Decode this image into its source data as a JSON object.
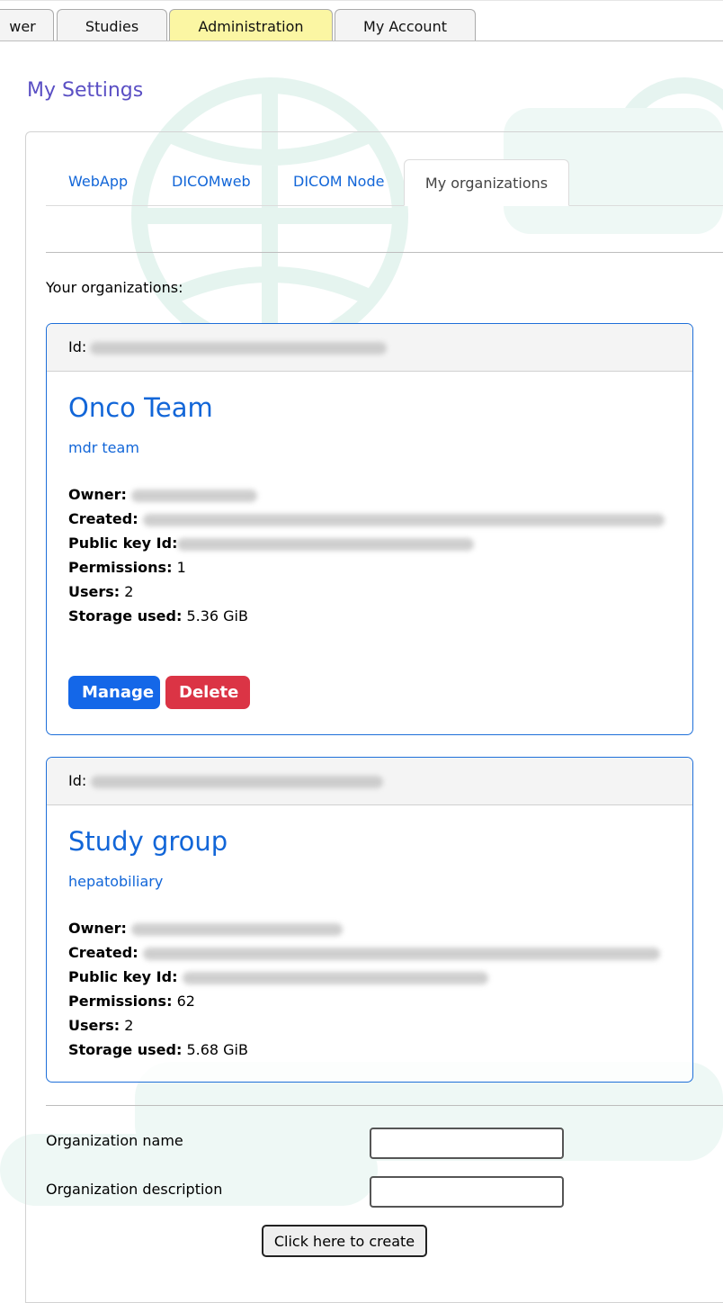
{
  "nav": {
    "tabs": [
      {
        "label": "wer"
      },
      {
        "label": "Studies"
      },
      {
        "label": "Administration"
      },
      {
        "label": "My Account"
      }
    ],
    "active_tab": "Administration"
  },
  "page": {
    "title": "My Settings"
  },
  "settings_tabs": [
    {
      "label": "WebApp"
    },
    {
      "label": "DICOMweb"
    },
    {
      "label": "DICOM Node"
    },
    {
      "label": "My organizations"
    }
  ],
  "organizations": {
    "heading": "Your organizations:",
    "items": [
      {
        "id_label": "Id:",
        "name": "Onco Team",
        "description": "mdr team",
        "owner_label": "Owner:",
        "created_label": "Created:",
        "public_key_label": "Public key Id:",
        "permissions_label": "Permissions:",
        "permissions": "1",
        "users_label": "Users:",
        "users": "2",
        "storage_label": "Storage used:",
        "storage": "5.36 GiB",
        "manage_label": "Manage",
        "delete_label": "Delete"
      },
      {
        "id_label": "Id:",
        "name": "Study group",
        "description": "hepatobiliary",
        "owner_label": "Owner:",
        "created_label": "Created:",
        "public_key_label": "Public key Id:",
        "permissions_label": "Permissions:",
        "permissions": "62",
        "users_label": "Users:",
        "users": "2",
        "storage_label": "Storage used:",
        "storage": "5.68 GiB"
      }
    ]
  },
  "create_form": {
    "name_label": "Organization name",
    "name_value": "",
    "description_label": "Organization description",
    "description_value": "",
    "submit_label": "Click here to create"
  },
  "colors": {
    "active_tab_bg": "#fbf6a3",
    "title": "#5a4fc4",
    "link": "#1266d8",
    "card_border": "#1e6fd9",
    "manage": "#1467e8",
    "delete": "#db3445"
  }
}
